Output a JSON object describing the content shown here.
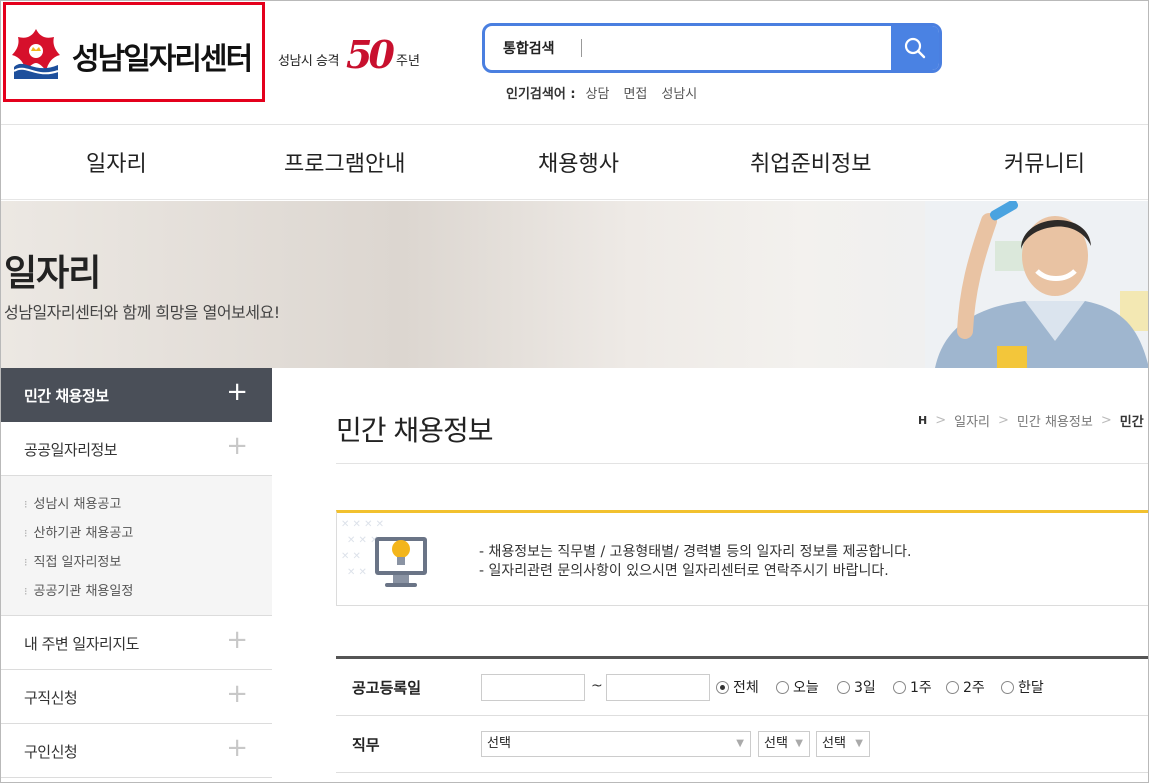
{
  "header": {
    "logo_text": "성남일자리센터",
    "anniversary": {
      "prefix": "성남시 승격",
      "number": "50",
      "suffix": "주년"
    },
    "search": {
      "value": "통합검색"
    },
    "popular": {
      "label": "인기검색어 :",
      "keywords": [
        "상담",
        "면접",
        "성남시"
      ]
    }
  },
  "gnb": [
    "일자리",
    "프로그램안내",
    "채용행사",
    "취업준비정보",
    "커뮤니티"
  ],
  "banner": {
    "title": "일자리",
    "subtitle": "성남일자리센터와 함께 희망을 열어보세요!"
  },
  "sidebar": {
    "items": [
      {
        "label": "민간 채용정보",
        "icon": "+"
      },
      {
        "label": "공공일자리정보",
        "icon": "+"
      },
      {
        "label": "내 주변 일자리지도",
        "icon": "+"
      },
      {
        "label": "구직신청",
        "icon": "+"
      },
      {
        "label": "구인신청",
        "icon": "+"
      }
    ],
    "subitems": [
      "성남시 채용공고",
      "산하기관 채용공고",
      "직접 일자리정보",
      "공공기관 채용일정"
    ]
  },
  "content": {
    "title": "민간 채용정보",
    "breadcrumb": {
      "home": "H",
      "items": [
        "일자리",
        "민간 채용정보"
      ],
      "current": "민간"
    },
    "notice": [
      "- 채용정보는 직무별 / 고용형태별/ 경력별 등의 일자리 정보를 제공합니다.",
      "- 일자리관련 문의사항이 있으시면 일자리센터로 연락주시기 바랍니다."
    ],
    "form": {
      "date_label": "공고등록일",
      "tilde": "~",
      "date_options": [
        "전체",
        "오늘",
        "3일",
        "1주",
        "2주",
        "한달"
      ],
      "selected_date_option": "전체",
      "job_label": "직무",
      "job_selects": [
        "선택",
        "선택",
        "선택"
      ]
    }
  },
  "colors": {
    "accent_blue": "#4a82e3",
    "logo_red": "#e4001c",
    "sidebar_active": "#4a4f58",
    "notice_yellow": "#f2c12e"
  }
}
